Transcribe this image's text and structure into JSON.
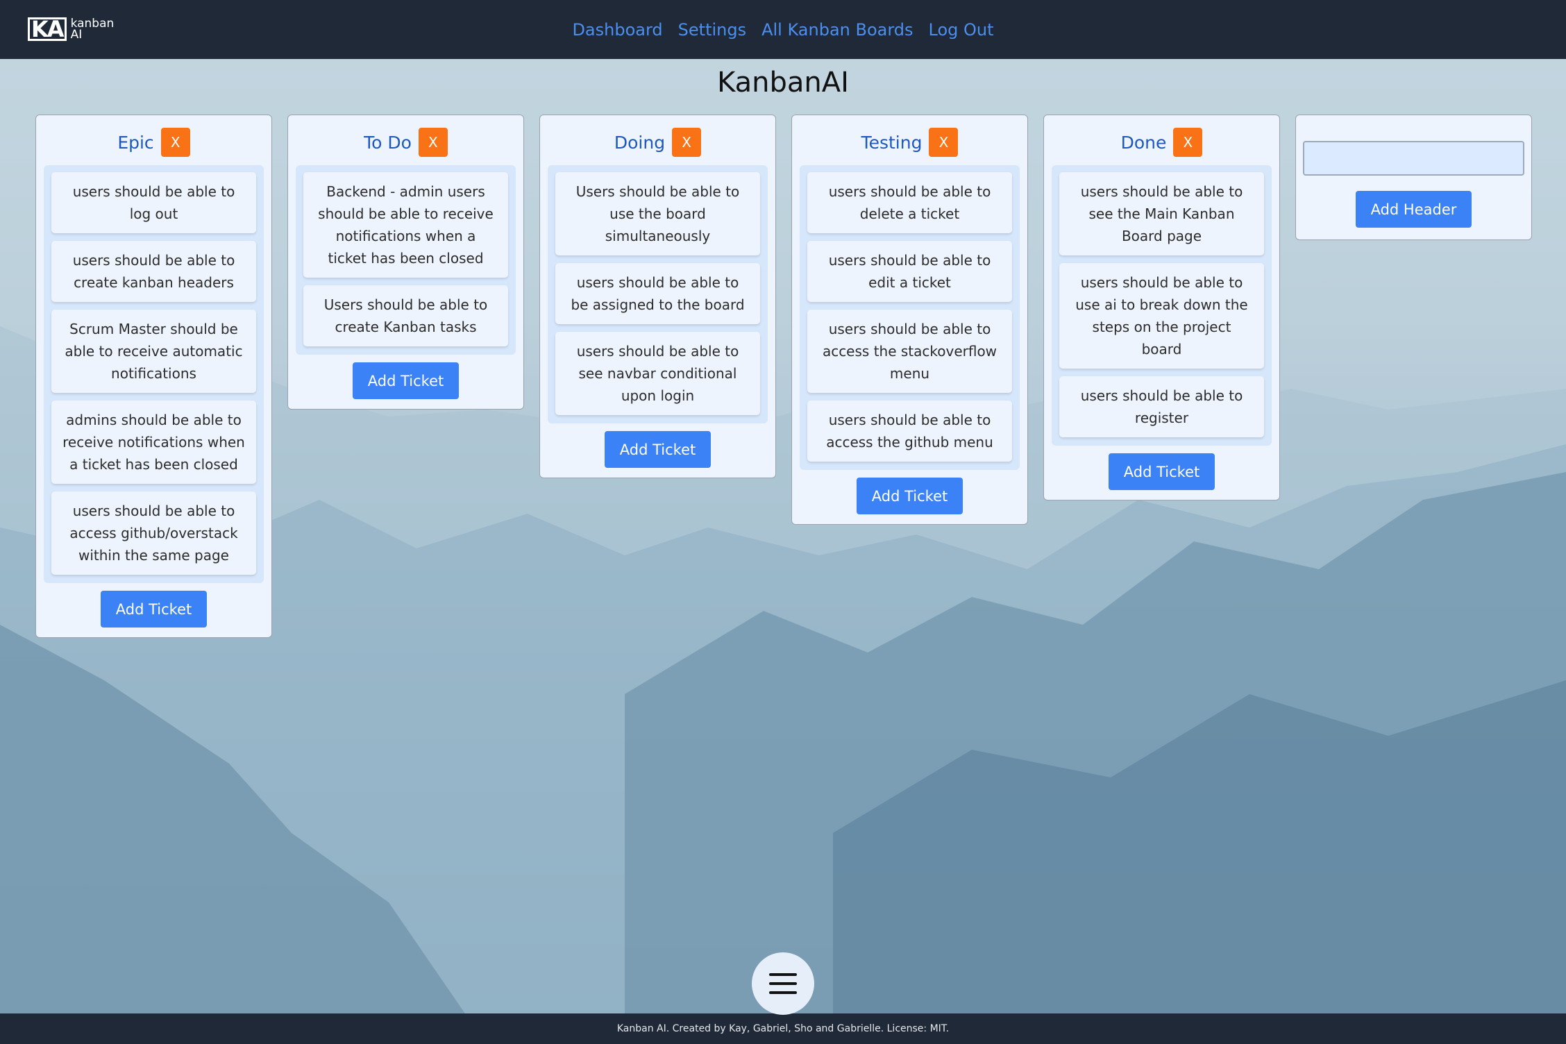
{
  "app": {
    "logo_mark": "KA",
    "logo_text_line1": "kanban",
    "logo_text_line2": "AI"
  },
  "nav": {
    "links": [
      {
        "label": "Dashboard"
      },
      {
        "label": "Settings"
      },
      {
        "label": "All Kanban Boards"
      },
      {
        "label": "Log Out"
      }
    ]
  },
  "page": {
    "title": "KanbanAI"
  },
  "board": {
    "delete_label": "X",
    "add_ticket_label": "Add Ticket",
    "add_header_label": "Add Header",
    "new_header_input_value": "",
    "columns": [
      {
        "title": "Epic",
        "tickets": [
          "users should be able to log out",
          "users should be able to create kanban headers",
          "Scrum Master should be able to receive automatic notifications",
          "admins should be able to receive notifications when a ticket has been closed",
          "users should be able to access github/overstack within the same page"
        ]
      },
      {
        "title": "To Do",
        "tickets": [
          "Backend - admin users should be able to receive notifications when a ticket has been closed",
          "Users should be able to create Kanban tasks"
        ]
      },
      {
        "title": "Doing",
        "tickets": [
          "Users should be able to use the board simultaneously",
          "users should be able to be assigned to the board",
          "users should be able to see navbar conditional upon login"
        ]
      },
      {
        "title": "Testing",
        "tickets": [
          "users should be able to delete a ticket",
          "users should be able to edit a ticket",
          "users should be able to access the stackoverflow menu",
          "users should be able to access the github menu"
        ]
      },
      {
        "title": "Done",
        "tickets": [
          "users should be able to see the Main Kanban Board page",
          "users should be able to use ai to break down the steps on the project board",
          "users should be able to register"
        ]
      }
    ]
  },
  "fab": {
    "icon": "hamburger-menu-icon"
  },
  "footer": {
    "text": "Kanban AI. Created by Kay, Gabriel, Sho and Gabrielle. License: MIT."
  }
}
